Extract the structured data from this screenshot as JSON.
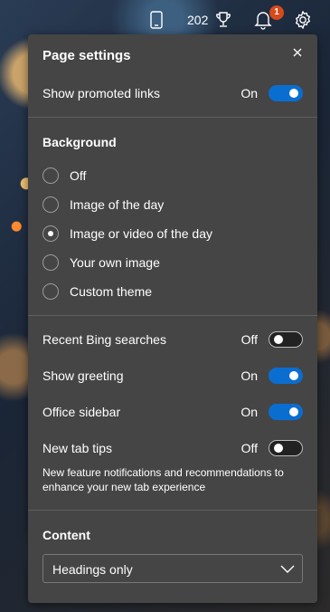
{
  "topbar": {
    "points": "202",
    "notification_count": "1",
    "icons": [
      "phone-icon",
      "trophy-icon",
      "bell-icon",
      "gear-icon"
    ]
  },
  "panel": {
    "title": "Page settings",
    "promoted_links": {
      "label": "Show promoted links",
      "state": "On"
    },
    "background": {
      "title": "Background",
      "options": [
        {
          "label": "Off",
          "selected": false
        },
        {
          "label": "Image of the day",
          "selected": false
        },
        {
          "label": "Image or video of the day",
          "selected": true
        },
        {
          "label": "Your own image",
          "selected": false
        },
        {
          "label": "Custom theme",
          "selected": false
        }
      ]
    },
    "toggles": [
      {
        "label": "Recent Bing searches",
        "state": "Off"
      },
      {
        "label": "Show greeting",
        "state": "On"
      },
      {
        "label": "Office sidebar",
        "state": "On"
      },
      {
        "label": "New tab tips",
        "state": "Off"
      }
    ],
    "tips_description": "New feature notifications and recommendations to enhance your new tab experience",
    "content": {
      "title": "Content",
      "selected": "Headings only"
    }
  },
  "colors": {
    "accent": "#0a6ed1",
    "panel": "#454545",
    "badge": "#d64a1c"
  }
}
